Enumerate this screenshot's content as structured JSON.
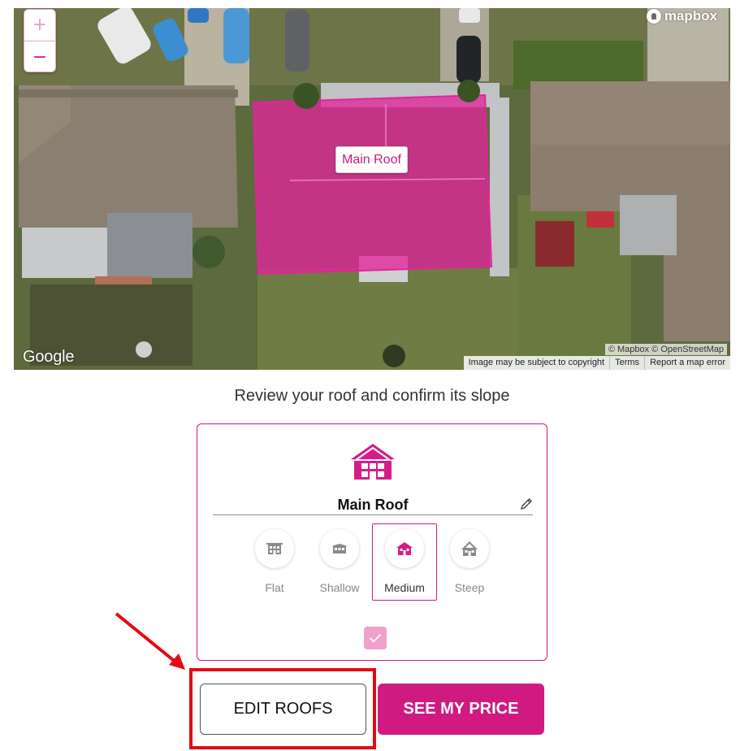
{
  "map": {
    "zoom_in": "+",
    "zoom_out": "−",
    "mapbox_logo": "mapbox",
    "google_logo": "Google",
    "roof_label": "Main Roof",
    "attribution": "© Mapbox © OpenStreetMap",
    "footer_links": [
      "Image may be subject to copyright",
      "Terms",
      "Report a map error"
    ]
  },
  "prompt": "Review your roof and confirm its slope",
  "roof_card": {
    "name": "Main Roof",
    "house_icon": "house-icon",
    "edit_icon": "pencil-icon",
    "slopes": [
      {
        "label": "Flat",
        "icon": "flat-roof-icon",
        "selected": false
      },
      {
        "label": "Shallow",
        "icon": "shallow-roof-icon",
        "selected": false
      },
      {
        "label": "Medium",
        "icon": "medium-roof-icon",
        "selected": true
      },
      {
        "label": "Steep",
        "icon": "steep-roof-icon",
        "selected": false
      }
    ],
    "confirm_icon": "check-icon"
  },
  "buttons": {
    "edit": "EDIT ROOFS",
    "price": "SEE MY PRICE"
  },
  "colors": {
    "accent": "#d01a82",
    "accent_light": "#f0a0cb",
    "annotation_red": "#e30b13"
  }
}
